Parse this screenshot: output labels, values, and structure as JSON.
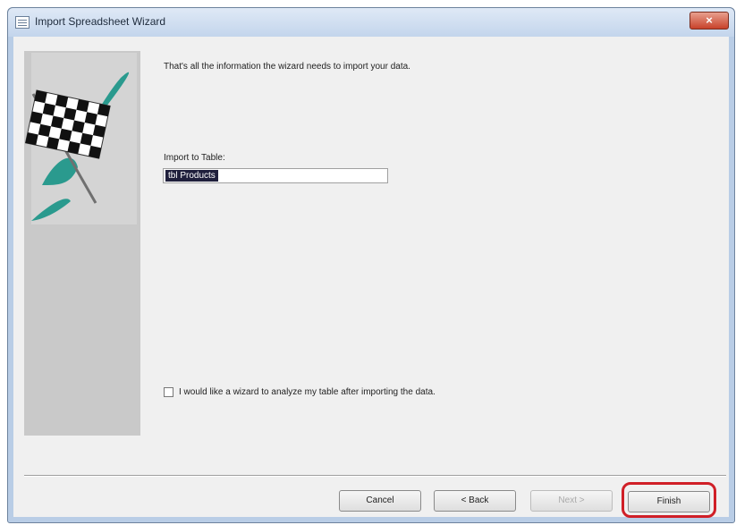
{
  "window": {
    "title": "Import Spreadsheet Wizard",
    "close_glyph": "×"
  },
  "wizard": {
    "message": "That's all the information the wizard needs to import your data.",
    "import_label": "Import to Table:",
    "import_value": "tbl Products",
    "analyze_checkbox_label": "I would like a wizard to analyze my table after importing the data.",
    "analyze_checked": false
  },
  "buttons": {
    "cancel": "Cancel",
    "back": "< Back",
    "next": "Next >",
    "finish": "Finish"
  },
  "icons": [
    "window-icon",
    "checkered-flag-icon"
  ],
  "colors": {
    "highlight": "#d01f27",
    "flag_teal": "#2a9a8e"
  }
}
